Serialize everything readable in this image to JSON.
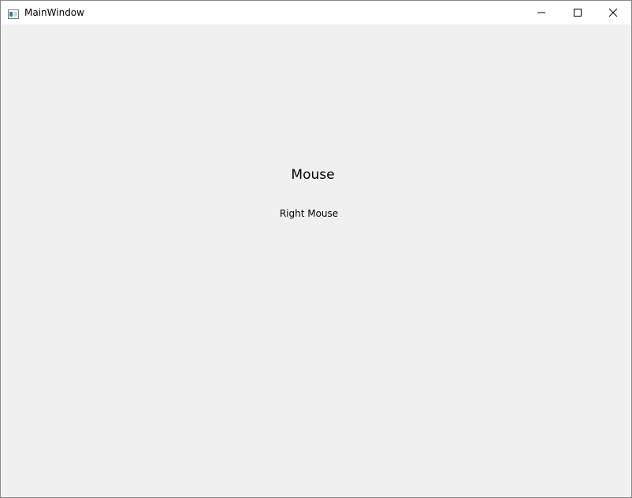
{
  "window": {
    "title": "MainWindow",
    "icon": "app-window-icon",
    "controls": {
      "minimize_icon": "minimize-icon",
      "maximize_icon": "maximize-icon",
      "close_icon": "close-icon"
    }
  },
  "content": {
    "heading": "Mouse",
    "status": "Right Mouse"
  },
  "colors": {
    "titlebar": "#ffffff",
    "client_background": "#f0f0f0",
    "text": "#000000"
  }
}
